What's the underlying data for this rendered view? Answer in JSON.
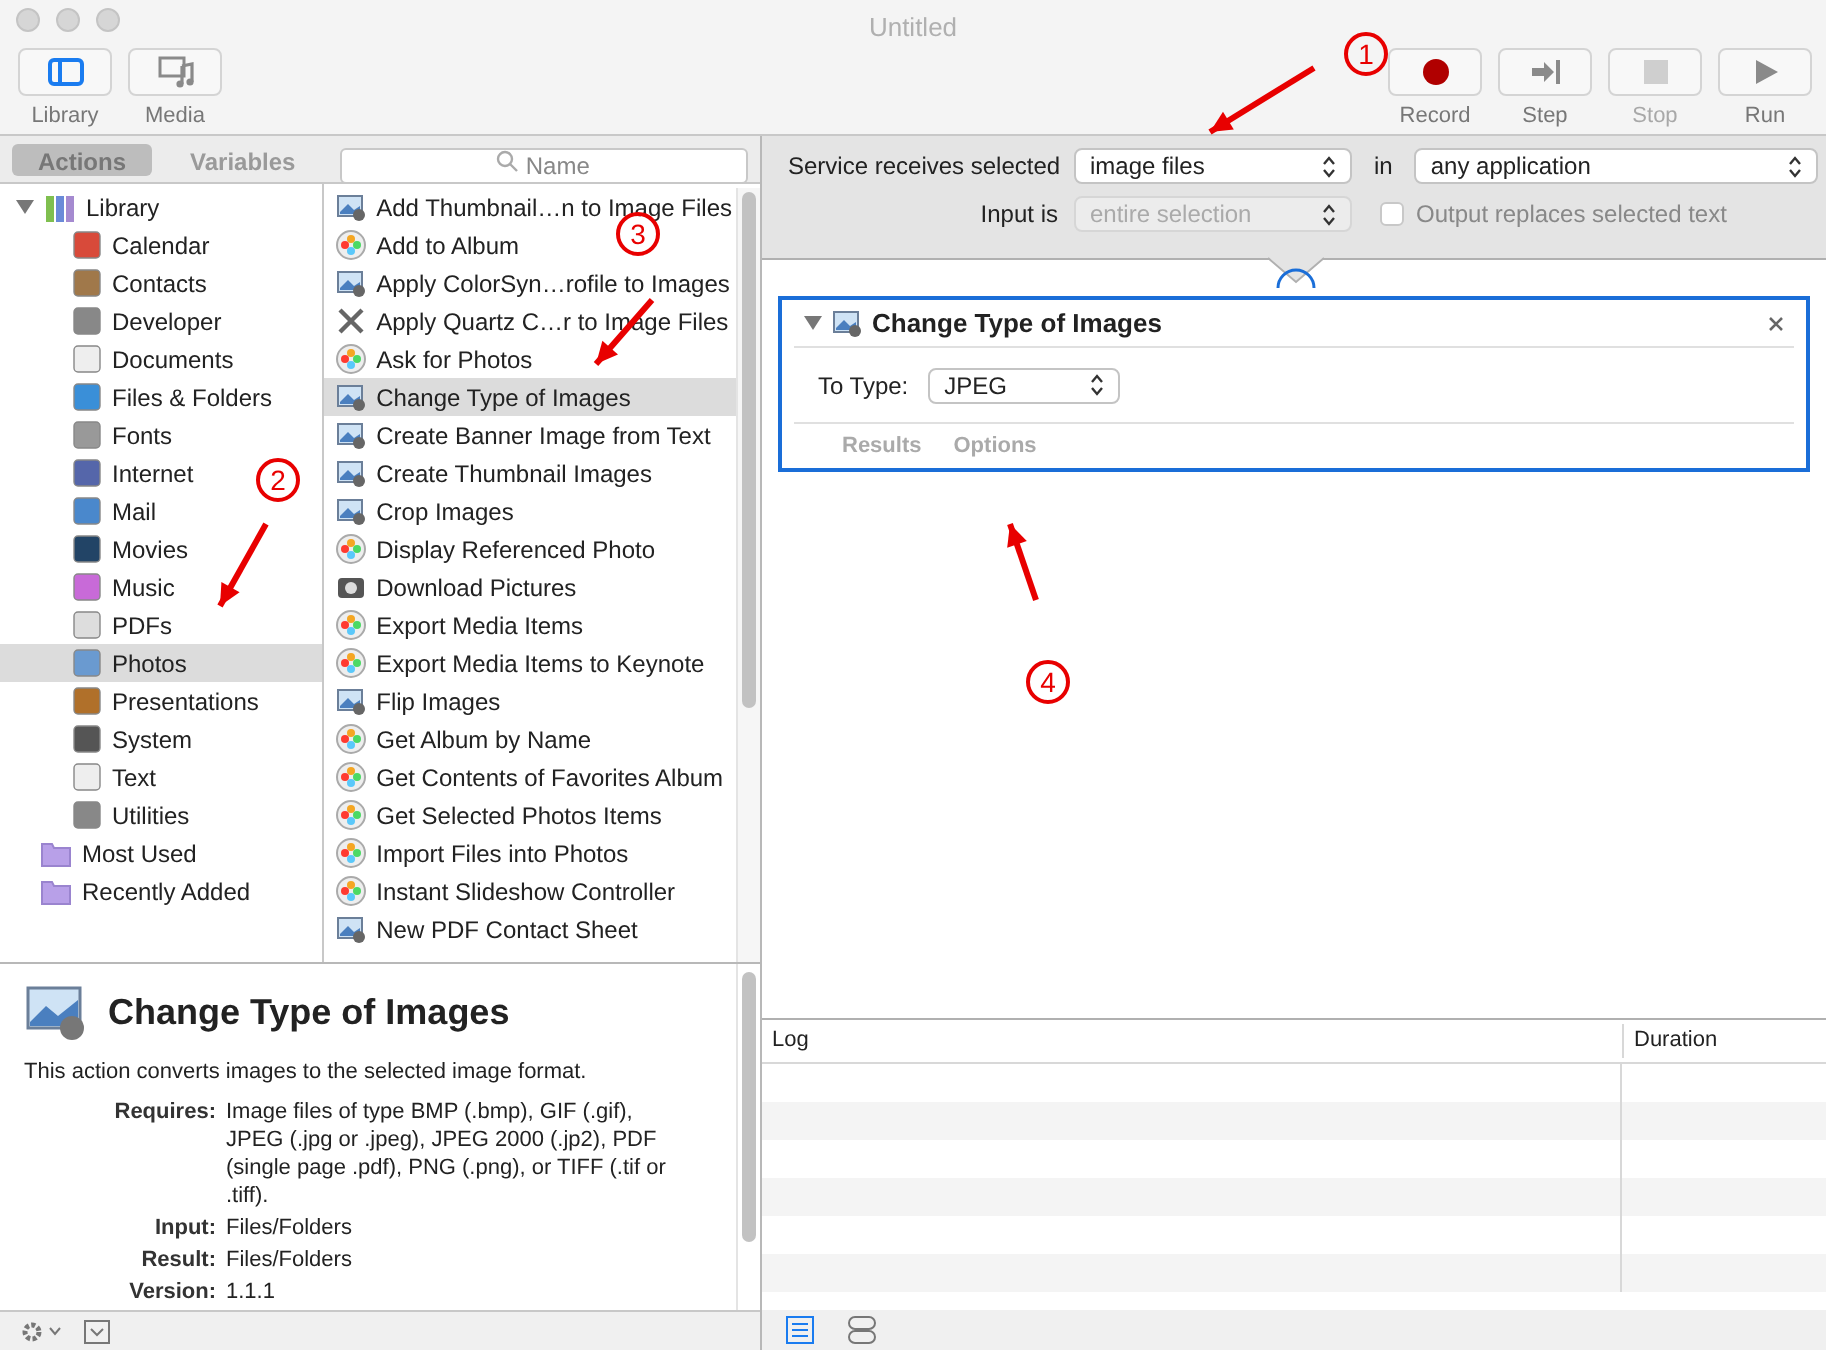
{
  "window": {
    "title": "Untitled"
  },
  "toolbar_left": [
    {
      "label": "Library",
      "selected": true,
      "kind": "library"
    },
    {
      "label": "Media",
      "selected": false,
      "kind": "media"
    }
  ],
  "toolbar_right": [
    {
      "label": "Record",
      "disabled": false,
      "kind": "record"
    },
    {
      "label": "Step",
      "disabled": false,
      "kind": "step"
    },
    {
      "label": "Stop",
      "disabled": true,
      "kind": "stop"
    },
    {
      "label": "Run",
      "disabled": false,
      "kind": "run"
    }
  ],
  "library_tabs": [
    {
      "label": "Actions",
      "selected": true
    },
    {
      "label": "Variables",
      "selected": false
    }
  ],
  "search": {
    "placeholder": "Name"
  },
  "categories": [
    {
      "label": "Library",
      "expanded": true,
      "selected": false,
      "children": [
        {
          "label": "Calendar",
          "selected": false
        },
        {
          "label": "Contacts",
          "selected": false
        },
        {
          "label": "Developer",
          "selected": false
        },
        {
          "label": "Documents",
          "selected": false
        },
        {
          "label": "Files & Folders",
          "selected": false
        },
        {
          "label": "Fonts",
          "selected": false
        },
        {
          "label": "Internet",
          "selected": false
        },
        {
          "label": "Mail",
          "selected": false
        },
        {
          "label": "Movies",
          "selected": false
        },
        {
          "label": "Music",
          "selected": false
        },
        {
          "label": "PDFs",
          "selected": false
        },
        {
          "label": "Photos",
          "selected": true
        },
        {
          "label": "Presentations",
          "selected": false
        },
        {
          "label": "System",
          "selected": false
        },
        {
          "label": "Text",
          "selected": false
        },
        {
          "label": "Utilities",
          "selected": false
        }
      ]
    },
    {
      "label": "Most Used",
      "selected": false
    },
    {
      "label": "Recently Added",
      "selected": false
    }
  ],
  "actions": [
    {
      "label": "Add Thumbnail…n to Image Files",
      "kind": "image",
      "selected": false
    },
    {
      "label": "Add to Album",
      "kind": "photos",
      "selected": false
    },
    {
      "label": "Apply ColorSyn…rofile to Images",
      "kind": "image",
      "selected": false
    },
    {
      "label": "Apply Quartz C…r to Image Files",
      "kind": "tool",
      "selected": false
    },
    {
      "label": "Ask for Photos",
      "kind": "photos",
      "selected": false
    },
    {
      "label": "Change Type of Images",
      "kind": "image",
      "selected": true
    },
    {
      "label": "Create Banner Image from Text",
      "kind": "image",
      "selected": false
    },
    {
      "label": "Create Thumbnail Images",
      "kind": "image",
      "selected": false
    },
    {
      "label": "Crop Images",
      "kind": "image",
      "selected": false
    },
    {
      "label": "Display Referenced Photo",
      "kind": "photos",
      "selected": false
    },
    {
      "label": "Download Pictures",
      "kind": "download",
      "selected": false
    },
    {
      "label": "Export Media Items",
      "kind": "photos",
      "selected": false
    },
    {
      "label": "Export Media Items to Keynote",
      "kind": "photos",
      "selected": false
    },
    {
      "label": "Flip Images",
      "kind": "image",
      "selected": false
    },
    {
      "label": "Get Album by Name",
      "kind": "photos",
      "selected": false
    },
    {
      "label": "Get Contents of Favorites Album",
      "kind": "photos",
      "selected": false
    },
    {
      "label": "Get Selected Photos Items",
      "kind": "photos",
      "selected": false
    },
    {
      "label": "Import Files into Photos",
      "kind": "photos",
      "selected": false
    },
    {
      "label": "Instant Slideshow Controller",
      "kind": "photos",
      "selected": false
    },
    {
      "label": "New PDF Contact Sheet",
      "kind": "image",
      "selected": false
    }
  ],
  "description": {
    "title": "Change Type of Images",
    "summary": "This action converts images to the selected image format.",
    "fields": [
      {
        "label": "Requires:",
        "value": "Image files of type BMP (.bmp), GIF (.gif), JPEG (.jpg or .jpeg), JPEG 2000 (.jp2), PDF (single page .pdf), PNG (.png), or TIFF (.tif or .tiff)."
      },
      {
        "label": "Input:",
        "value": "Files/Folders"
      },
      {
        "label": "Result:",
        "value": "Files/Folders"
      },
      {
        "label": "Version:",
        "value": "1.1.1"
      }
    ]
  },
  "service": {
    "receives_label": "Service receives selected",
    "receives_value": "image files",
    "in_label": "in",
    "in_value": "any application",
    "input_label": "Input is",
    "input_value": "entire selection",
    "input_disabled": true,
    "output_replaces": {
      "label": "Output replaces selected text",
      "checked": false,
      "disabled": true
    }
  },
  "workflow_action": {
    "title": "Change Type of Images",
    "expanded": true,
    "selected": true,
    "to_type_label": "To Type:",
    "to_type_value": "JPEG",
    "tabs": [
      "Results",
      "Options"
    ]
  },
  "log": {
    "columns": [
      "Log",
      "Duration"
    ]
  },
  "annotations": [
    "1",
    "2",
    "3",
    "4"
  ]
}
